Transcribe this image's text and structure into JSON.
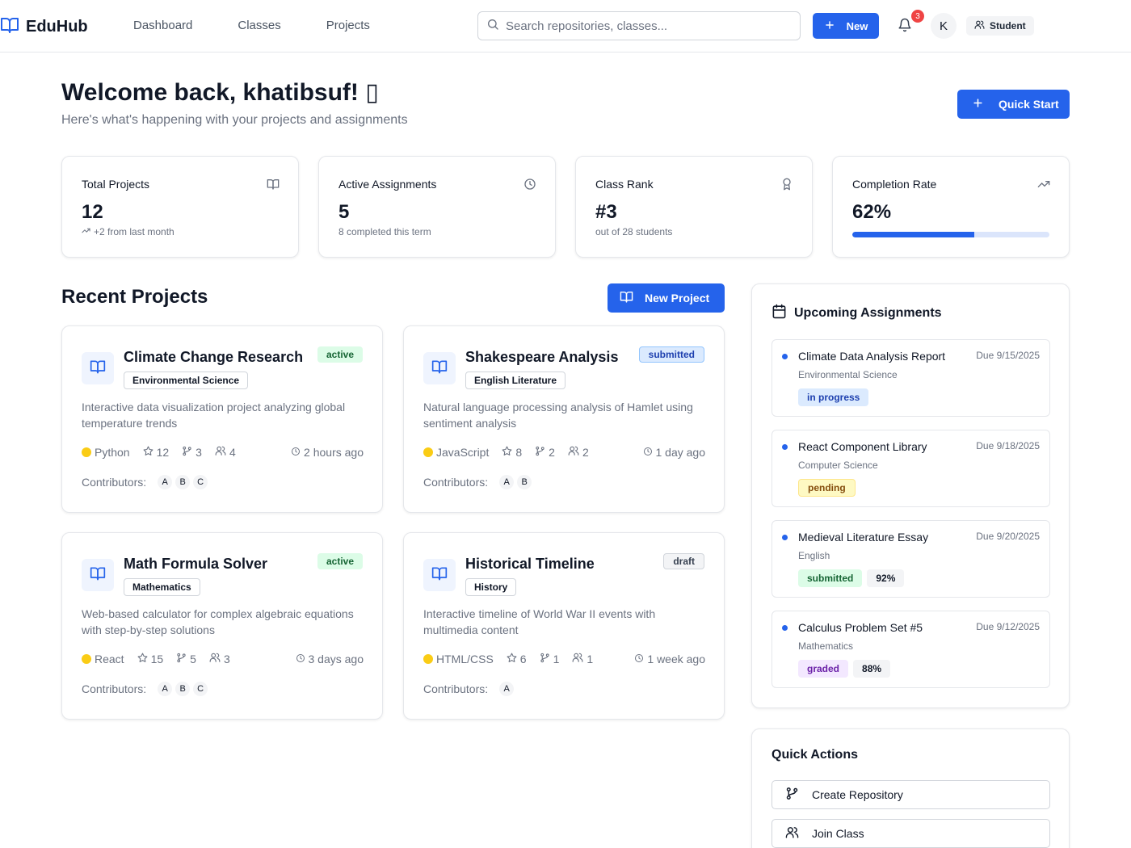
{
  "brand": {
    "name": "EduHub",
    "icon": "book-open-icon",
    "accent": "#2563eb"
  },
  "nav": [
    {
      "label": "Dashboard"
    },
    {
      "label": "Classes"
    },
    {
      "label": "Projects"
    }
  ],
  "search": {
    "placeholder": "Search repositories, classes...",
    "value": ""
  },
  "header_actions": {
    "new_label": "New",
    "notifications_count": "3",
    "avatar_initial": "K",
    "role_label": "Student"
  },
  "welcome": {
    "title": "Welcome back, khatibsuf! ▯",
    "subtitle": "Here's what's happening with your projects and assignments",
    "quick_start_label": "Quick Start"
  },
  "stats": [
    {
      "label": "Total Projects",
      "value": "12",
      "sub": "+2 from last month",
      "icon": "book-open-icon"
    },
    {
      "label": "Active Assignments",
      "value": "5",
      "sub": "8 completed this term",
      "icon": "clock-icon"
    },
    {
      "label": "Class Rank",
      "value": "#3",
      "sub": "out of 28 students",
      "icon": "award-icon"
    },
    {
      "label": "Completion Rate",
      "value": "62%",
      "progress": 62,
      "icon": "trending-up-icon"
    }
  ],
  "recent_projects": {
    "title": "Recent Projects",
    "new_project_label": "New Project",
    "contributors_label": "Contributors:",
    "items": [
      {
        "title": "Climate Change Research",
        "subject": "Environmental Science",
        "status": "active",
        "description": "Interactive data visualization project analyzing global temperature trends",
        "language": "Python",
        "language_color": "#facc15",
        "stars": "12",
        "forks": "3",
        "members": "4",
        "updated": "2 hours ago",
        "contributors": [
          "A",
          "B",
          "C"
        ]
      },
      {
        "title": "Shakespeare Analysis",
        "subject": "English Literature",
        "status": "submitted",
        "description": "Natural language processing analysis of Hamlet using sentiment analysis",
        "language": "JavaScript",
        "language_color": "#facc15",
        "stars": "8",
        "forks": "2",
        "members": "2",
        "updated": "1 day ago",
        "contributors": [
          "A",
          "B"
        ]
      },
      {
        "title": "Math Formula Solver",
        "subject": "Mathematics",
        "status": "active",
        "description": "Web-based calculator for complex algebraic equations with step-by-step solutions",
        "language": "React",
        "language_color": "#facc15",
        "stars": "15",
        "forks": "5",
        "members": "3",
        "updated": "3 days ago",
        "contributors": [
          "A",
          "B",
          "C"
        ]
      },
      {
        "title": "Historical Timeline",
        "subject": "History",
        "status": "draft",
        "description": "Interactive timeline of World War II events with multimedia content",
        "language": "HTML/CSS",
        "language_color": "#facc15",
        "stars": "6",
        "forks": "1",
        "members": "1",
        "updated": "1 week ago",
        "contributors": [
          "A"
        ]
      }
    ]
  },
  "assignments": {
    "title": "Upcoming Assignments",
    "icon": "calendar-icon",
    "items": [
      {
        "title": "Climate Data Analysis Report",
        "due": "Due 9/15/2025",
        "course": "Environmental Science",
        "status": "in progress",
        "grade": ""
      },
      {
        "title": "React Component Library",
        "due": "Due 9/18/2025",
        "course": "Computer Science",
        "status": "pending",
        "grade": ""
      },
      {
        "title": "Medieval Literature Essay",
        "due": "Due 9/20/2025",
        "course": "English",
        "status": "submitted",
        "grade": "92%"
      },
      {
        "title": "Calculus Problem Set #5",
        "due": "Due 9/12/2025",
        "course": "Mathematics",
        "status": "graded",
        "grade": "88%"
      }
    ]
  },
  "quick_actions": {
    "title": "Quick Actions",
    "items": [
      {
        "label": "Create Repository",
        "icon": "git-branch-icon"
      },
      {
        "label": "Join Class",
        "icon": "users-icon"
      }
    ]
  }
}
